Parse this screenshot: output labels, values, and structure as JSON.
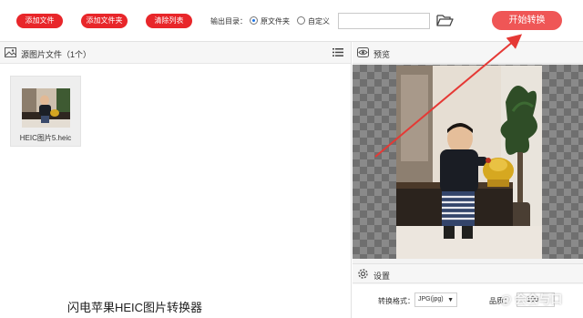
{
  "toolbar": {
    "add_file_label": "添加文件",
    "add_folder_label": "添加文件夹",
    "clear_list_label": "清除列表",
    "output_dir_label": "输出目录：",
    "option_source_folder": "原文件夹",
    "option_custom": "自定义",
    "output_path_value": "",
    "start_button_label": "开始转换",
    "folder_icon": "folder-open-icon"
  },
  "left_panel": {
    "title": "源图片文件（1个）",
    "header_icon": "image-icon",
    "list_icon": "list-view-icon",
    "files": [
      {
        "name": "HEIC图片5.heic"
      }
    ]
  },
  "right_panel": {
    "preview_title": "预览",
    "preview_icon": "eye-icon",
    "settings_title": "设置",
    "settings_icon": "gear-icon",
    "format_label": "转换格式：",
    "format_value": "JPG(jpg)",
    "quality_label": "品质：",
    "quality_value": "100"
  },
  "app_name": "闪电苹果HEIC图片转换器",
  "watermark": "@ 会会与口",
  "colors": {
    "button_red": "#e8262a",
    "start_button": "#ef5656",
    "annotation_arrow": "#e53935",
    "radio_selected": "#1a73e8"
  }
}
